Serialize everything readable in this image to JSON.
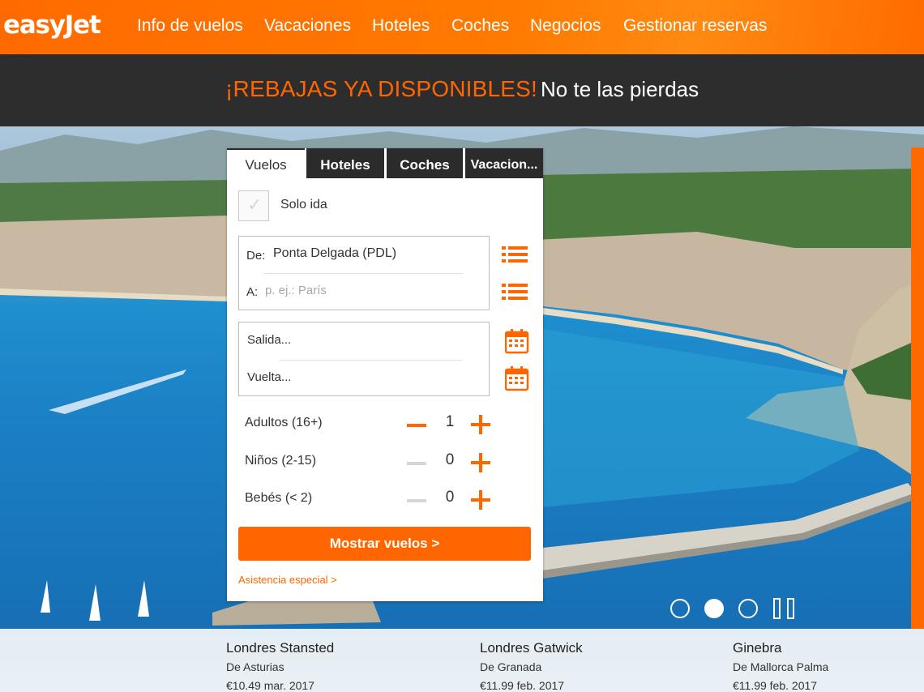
{
  "brand": {
    "logo": "easyJet"
  },
  "nav": {
    "items": [
      "Info de vuelos",
      "Vacaciones",
      "Hoteles",
      "Coches",
      "Negocios",
      "Gestionar reservas"
    ]
  },
  "promo": {
    "headline": "¡REBAJAS YA DISPONIBLES!",
    "subtext": "No te las pierdas"
  },
  "search": {
    "tabs": [
      "Vuelos",
      "Hoteles",
      "Coches",
      "Vacacion..."
    ],
    "active_tab": "Vuelos",
    "one_way_label": "Solo ida",
    "from_prefix": "De:",
    "from_value": "Ponta Delgada (PDL)",
    "to_prefix": "A:",
    "to_placeholder": "p. ej.: París",
    "departure_placeholder": "Salida...",
    "return_placeholder": "Vuelta...",
    "passengers": [
      {
        "label": "Adultos (16+)",
        "count": "1"
      },
      {
        "label": "Niños (2-15)",
        "count": "0"
      },
      {
        "label": "Bebés (< 2)",
        "count": "0"
      }
    ],
    "submit_label": "Mostrar vuelos >",
    "assistance_link": "Asistencia especial >"
  },
  "carousel": {
    "active_slide": 2,
    "slides": 3
  },
  "deals": [
    {
      "city": "Londres Stansted",
      "from": "De Asturias",
      "price": "€10.49  mar. 2017"
    },
    {
      "city": "Londres Gatwick",
      "from": "De Granada",
      "price": "€11.99  feb. 2017"
    },
    {
      "city": "Ginebra",
      "from": "De Mallorca Palma",
      "price": "€11.99  feb. 2017"
    }
  ],
  "colors": {
    "brand_orange": "#ff6600",
    "banner_dark": "#2d2d2d",
    "sea": "#1b7fc4"
  },
  "icons": [
    "list-icon",
    "calendar-icon",
    "checkmark-icon",
    "minus-icon",
    "plus-icon",
    "pause-icon"
  ]
}
